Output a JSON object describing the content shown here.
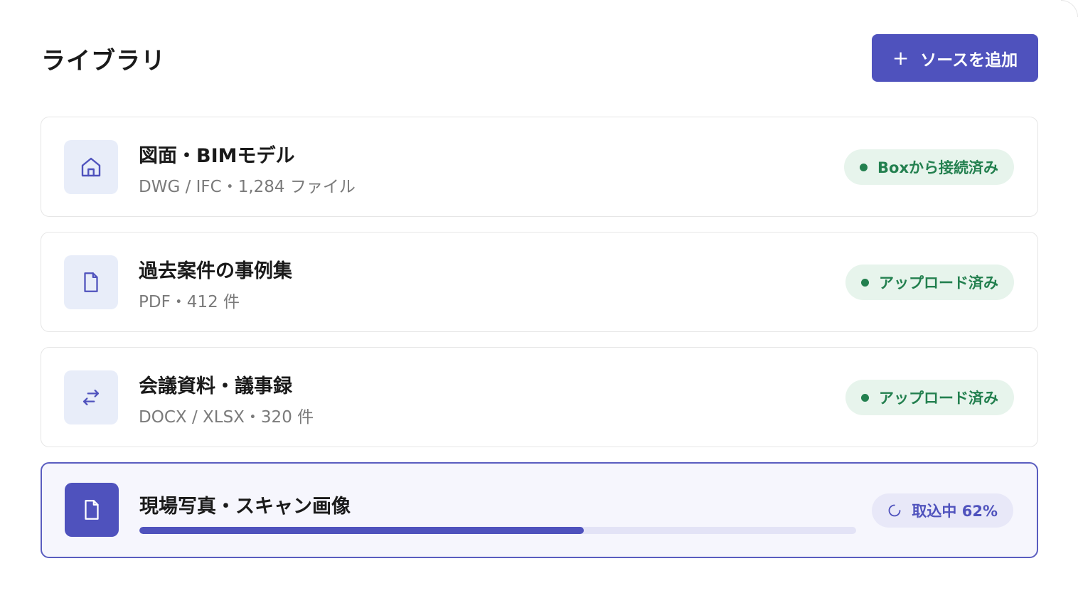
{
  "header": {
    "title": "ライブラリ",
    "add_button_label": "ソースを追加",
    "add_button_icon": "+"
  },
  "sources": [
    {
      "name": "図面・BIMモデル",
      "meta": "DWG / IFC・1,284 ファイル",
      "status": "Boxから接続済み",
      "icon": "home-icon"
    },
    {
      "name": "過去案件の事例集",
      "meta": "PDF・412 件",
      "status": "アップロード済み",
      "icon": "document-icon"
    },
    {
      "name": "会議資料・議事録",
      "meta": "DOCX / XLSX・320 件",
      "status": "アップロード済み",
      "icon": "sync-arrows-icon"
    },
    {
      "name": "現場写真・スキャン画像",
      "status": "取込中 62%",
      "progress": 0.62,
      "icon": "document-icon"
    }
  ],
  "colors": {
    "accent": "#4f52bd",
    "success": "#23804f",
    "success_bg": "#e7f4ec"
  }
}
